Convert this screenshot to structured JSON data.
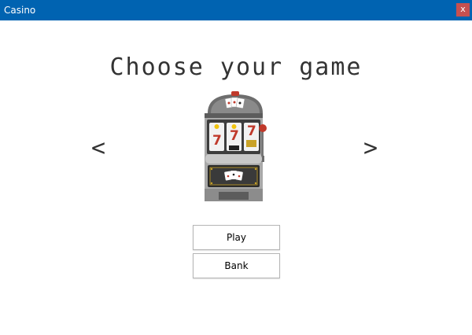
{
  "window": {
    "title": "Casino",
    "close_label": "x"
  },
  "main": {
    "heading": "Choose your game",
    "prev_arrow": "<",
    "next_arrow": ">",
    "game_icon": "slot-machine-icon",
    "buttons": {
      "play": "Play",
      "bank": "Bank"
    }
  },
  "colors": {
    "titlebar": "#0063b1",
    "close": "#c75050",
    "heading": "#333333"
  }
}
